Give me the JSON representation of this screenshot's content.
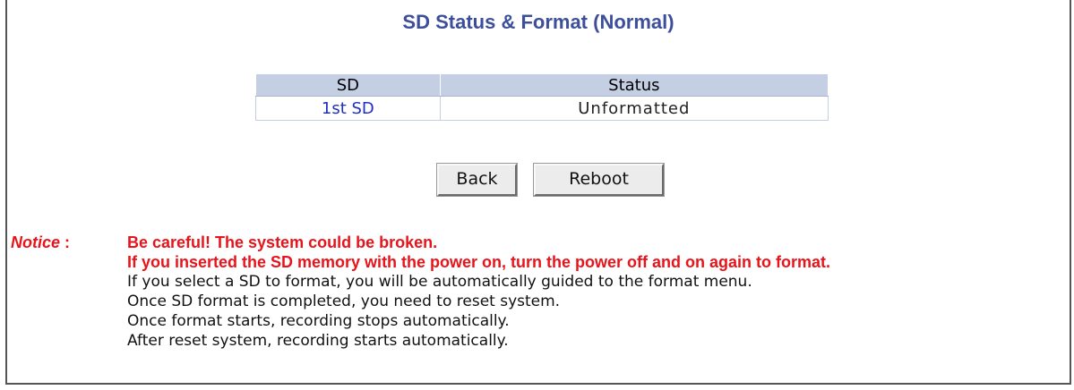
{
  "page": {
    "title": "SD Status & Format (Normal)"
  },
  "table": {
    "headers": [
      "SD",
      "Status"
    ],
    "rows": [
      {
        "sd": "1st SD",
        "status": "Unformatted"
      }
    ]
  },
  "buttons": {
    "back_label": "Back",
    "reboot_label": "Reboot"
  },
  "notice": {
    "label": "Notice",
    "separator": " : ",
    "warnings": [
      "Be careful! The system could be broken.",
      "If you inserted the SD memory with the power on, turn the power off and on again to format."
    ],
    "info": [
      "If you select a SD to format, you will be automatically guided to the format menu.",
      "Once SD format is completed, you need to reset system.",
      "Once format starts, recording stops automatically.",
      "After reset system, recording starts automatically."
    ]
  },
  "colors": {
    "title": "#3d4f9a",
    "table_header_bg": "#c5cfe4",
    "link": "#1f2fc2",
    "warning": "#e8141b"
  }
}
